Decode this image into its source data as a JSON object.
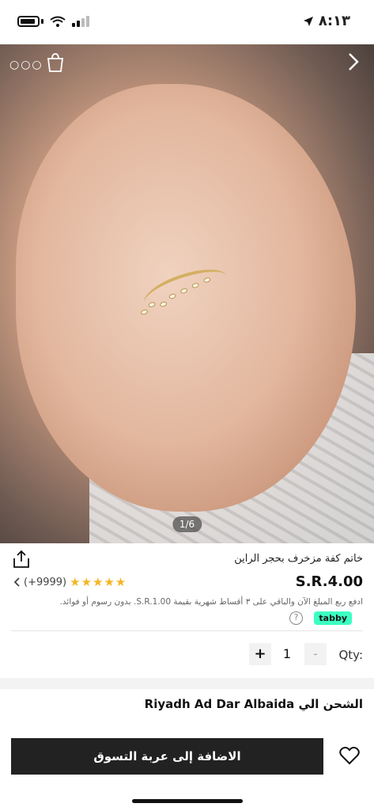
{
  "status_bar": {
    "time": "٨:١٣"
  },
  "hero": {
    "image_counter": "1/6"
  },
  "product": {
    "title": "خاتم كفة مزخرف بحجر الراين",
    "price": "S.R.4.00",
    "rating_count": "(+9999)",
    "rating_stars": "★★★★★",
    "installment_text": "ادفع ربع المبلغ الآن والباقي على ٣ أقساط شهرية بقيمة S.R.1.00. بدون رسوم أو فوائد.",
    "tabby_badge": "tabby",
    "help_symbol": "?"
  },
  "quantity": {
    "label": "Qty:",
    "value": "1",
    "minus": "-",
    "plus": "+"
  },
  "shipping": {
    "text": "الشحن الي Riyadh Ad Dar Albaida"
  },
  "bottom_bar": {
    "add_to_cart": "الاضافة إلى عربة التسوق"
  },
  "colors": {
    "accent_dark": "#222222",
    "tabby": "#3bffc1",
    "stars": "#f3b623"
  }
}
